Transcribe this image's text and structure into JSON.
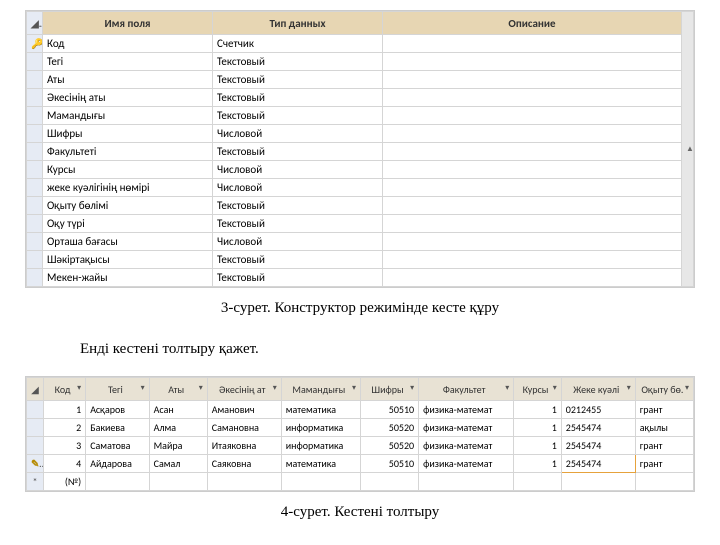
{
  "table1": {
    "headers": [
      "Имя поля",
      "Тип данных",
      "Описание"
    ],
    "rows": [
      {
        "field": "Код",
        "type": "Счетчик"
      },
      {
        "field": "Тегі",
        "type": "Текстовый"
      },
      {
        "field": "Аты",
        "type": "Текстовый"
      },
      {
        "field": "Әкесінің аты",
        "type": "Текстовый"
      },
      {
        "field": "Мамандығы",
        "type": "Текстовый"
      },
      {
        "field": "Шифры",
        "type": "Числовой"
      },
      {
        "field": "Факультеті",
        "type": "Текстовый"
      },
      {
        "field": "Курсы",
        "type": "Числовой"
      },
      {
        "field": "жеке куәлігінің нөмірі",
        "type": "Числовой"
      },
      {
        "field": "Оқыту бөлімі",
        "type": "Текстовый"
      },
      {
        "field": "Оқу түрі",
        "type": "Текстовый"
      },
      {
        "field": "Орташа бағасы",
        "type": "Числовой"
      },
      {
        "field": "Шәкіртақысы",
        "type": "Текстовый"
      },
      {
        "field": "Мекен-жайы",
        "type": "Текстовый"
      }
    ]
  },
  "caption1": "3-сурет. Конструктор режимінде кесте құру",
  "caption2": "Енді кестені толтыру қажет.",
  "table2": {
    "headers": [
      "Код",
      "Тегі",
      "Аты",
      "Әкесінің ат",
      "Мамандығы",
      "Шифры",
      "Факультет",
      "Курсы",
      "Жеке куәлі",
      "Оқыту бө."
    ],
    "rows": [
      {
        "id": "1",
        "teg": "Асқаров",
        "aty": "Асан",
        "ake": "Аманович",
        "mam": "математика",
        "shi": "50510",
        "fak": "физика-математ",
        "kur": "1",
        "jk": "0212455",
        "ob": "грант"
      },
      {
        "id": "2",
        "teg": "Бакиева",
        "aty": "Алма",
        "ake": "Самановна",
        "mam": "информатика",
        "shi": "50520",
        "fak": "физика-математ",
        "kur": "1",
        "jk": "2545474",
        "ob": "ақылы"
      },
      {
        "id": "3",
        "teg": "Саматова",
        "aty": "Майра",
        "ake": "Итаяковна",
        "mam": "информатика",
        "shi": "50520",
        "fak": "физика-математ",
        "kur": "1",
        "jk": "2545474",
        "ob": "грант"
      },
      {
        "id": "4",
        "teg": "Айдарова",
        "aty": "Самал",
        "ake": "Саяковна",
        "mam": "математика",
        "shi": "50510",
        "fak": "физика-математ",
        "kur": "1",
        "jk": "2545474",
        "ob": "грант"
      }
    ],
    "newRow": "(№)"
  },
  "caption3": "4-сурет. Кестені толтыру",
  "icons": {
    "key": "🔑",
    "pencil": "✎",
    "star": "*",
    "drop": "▾",
    "up": "▲",
    "down": "▼"
  }
}
